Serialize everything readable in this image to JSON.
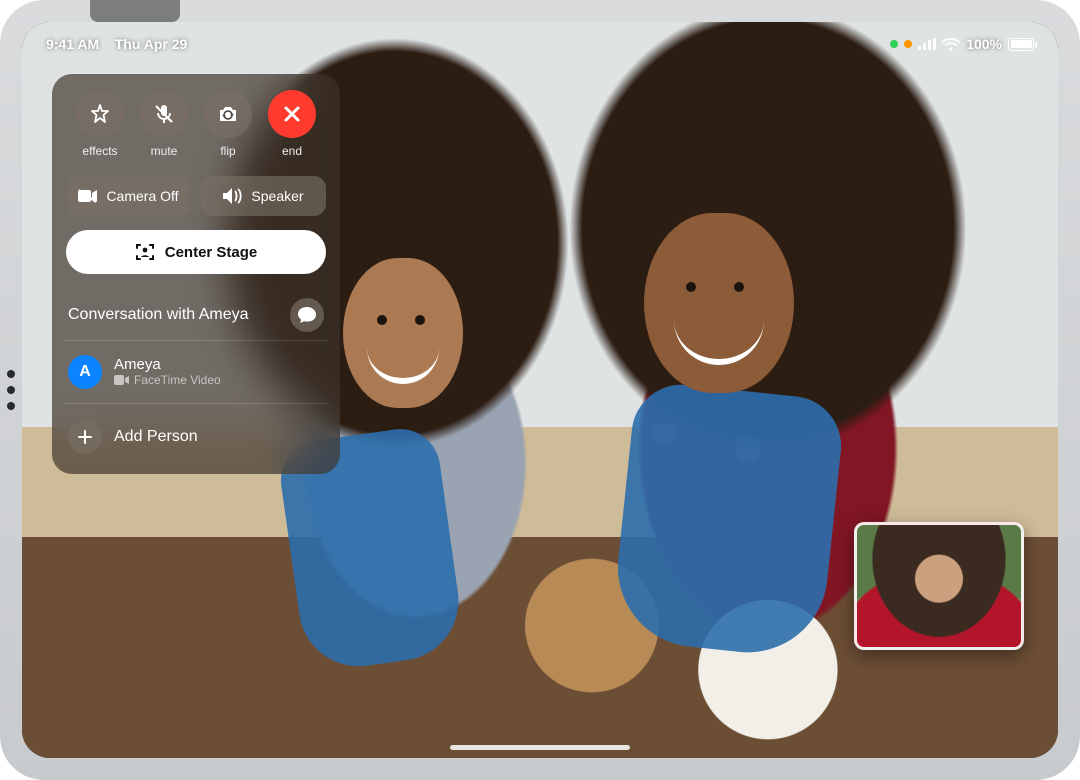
{
  "status": {
    "time": "9:41 AM",
    "date": "Thu Apr 29",
    "battery_pct": "100%"
  },
  "controls": {
    "effects": "effects",
    "mute": "mute",
    "flip": "flip",
    "end": "end",
    "camera_off": "Camera Off",
    "speaker": "Speaker",
    "center_stage": "Center Stage"
  },
  "conversation": {
    "title": "Conversation with Ameya"
  },
  "participant": {
    "initial": "A",
    "name": "Ameya",
    "subtitle": "FaceTime Video"
  },
  "add_person": "Add Person",
  "colors": {
    "end_red": "#ff3b30",
    "accent_blue": "#0a84ff"
  }
}
